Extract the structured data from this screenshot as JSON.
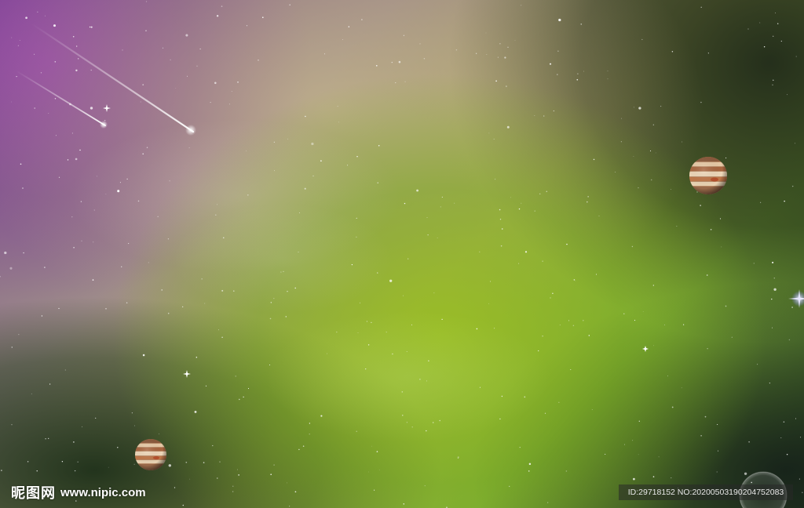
{
  "scene": {
    "description_colors": {
      "purple": "#8a4f9c",
      "beige": "#c9b894",
      "green": "#9fc23a",
      "dark": "#1a2418"
    }
  },
  "watermark": {
    "logo_text": "昵图网",
    "site": "www.nipic.com",
    "id_text": "ID:29718152 NO:20200503190204752083"
  },
  "icons": {
    "planet": "jupiter-planet-icon",
    "meteor": "shooting-star-icon",
    "star": "sparkle-star-icon",
    "moon": "translucent-moon-icon"
  }
}
